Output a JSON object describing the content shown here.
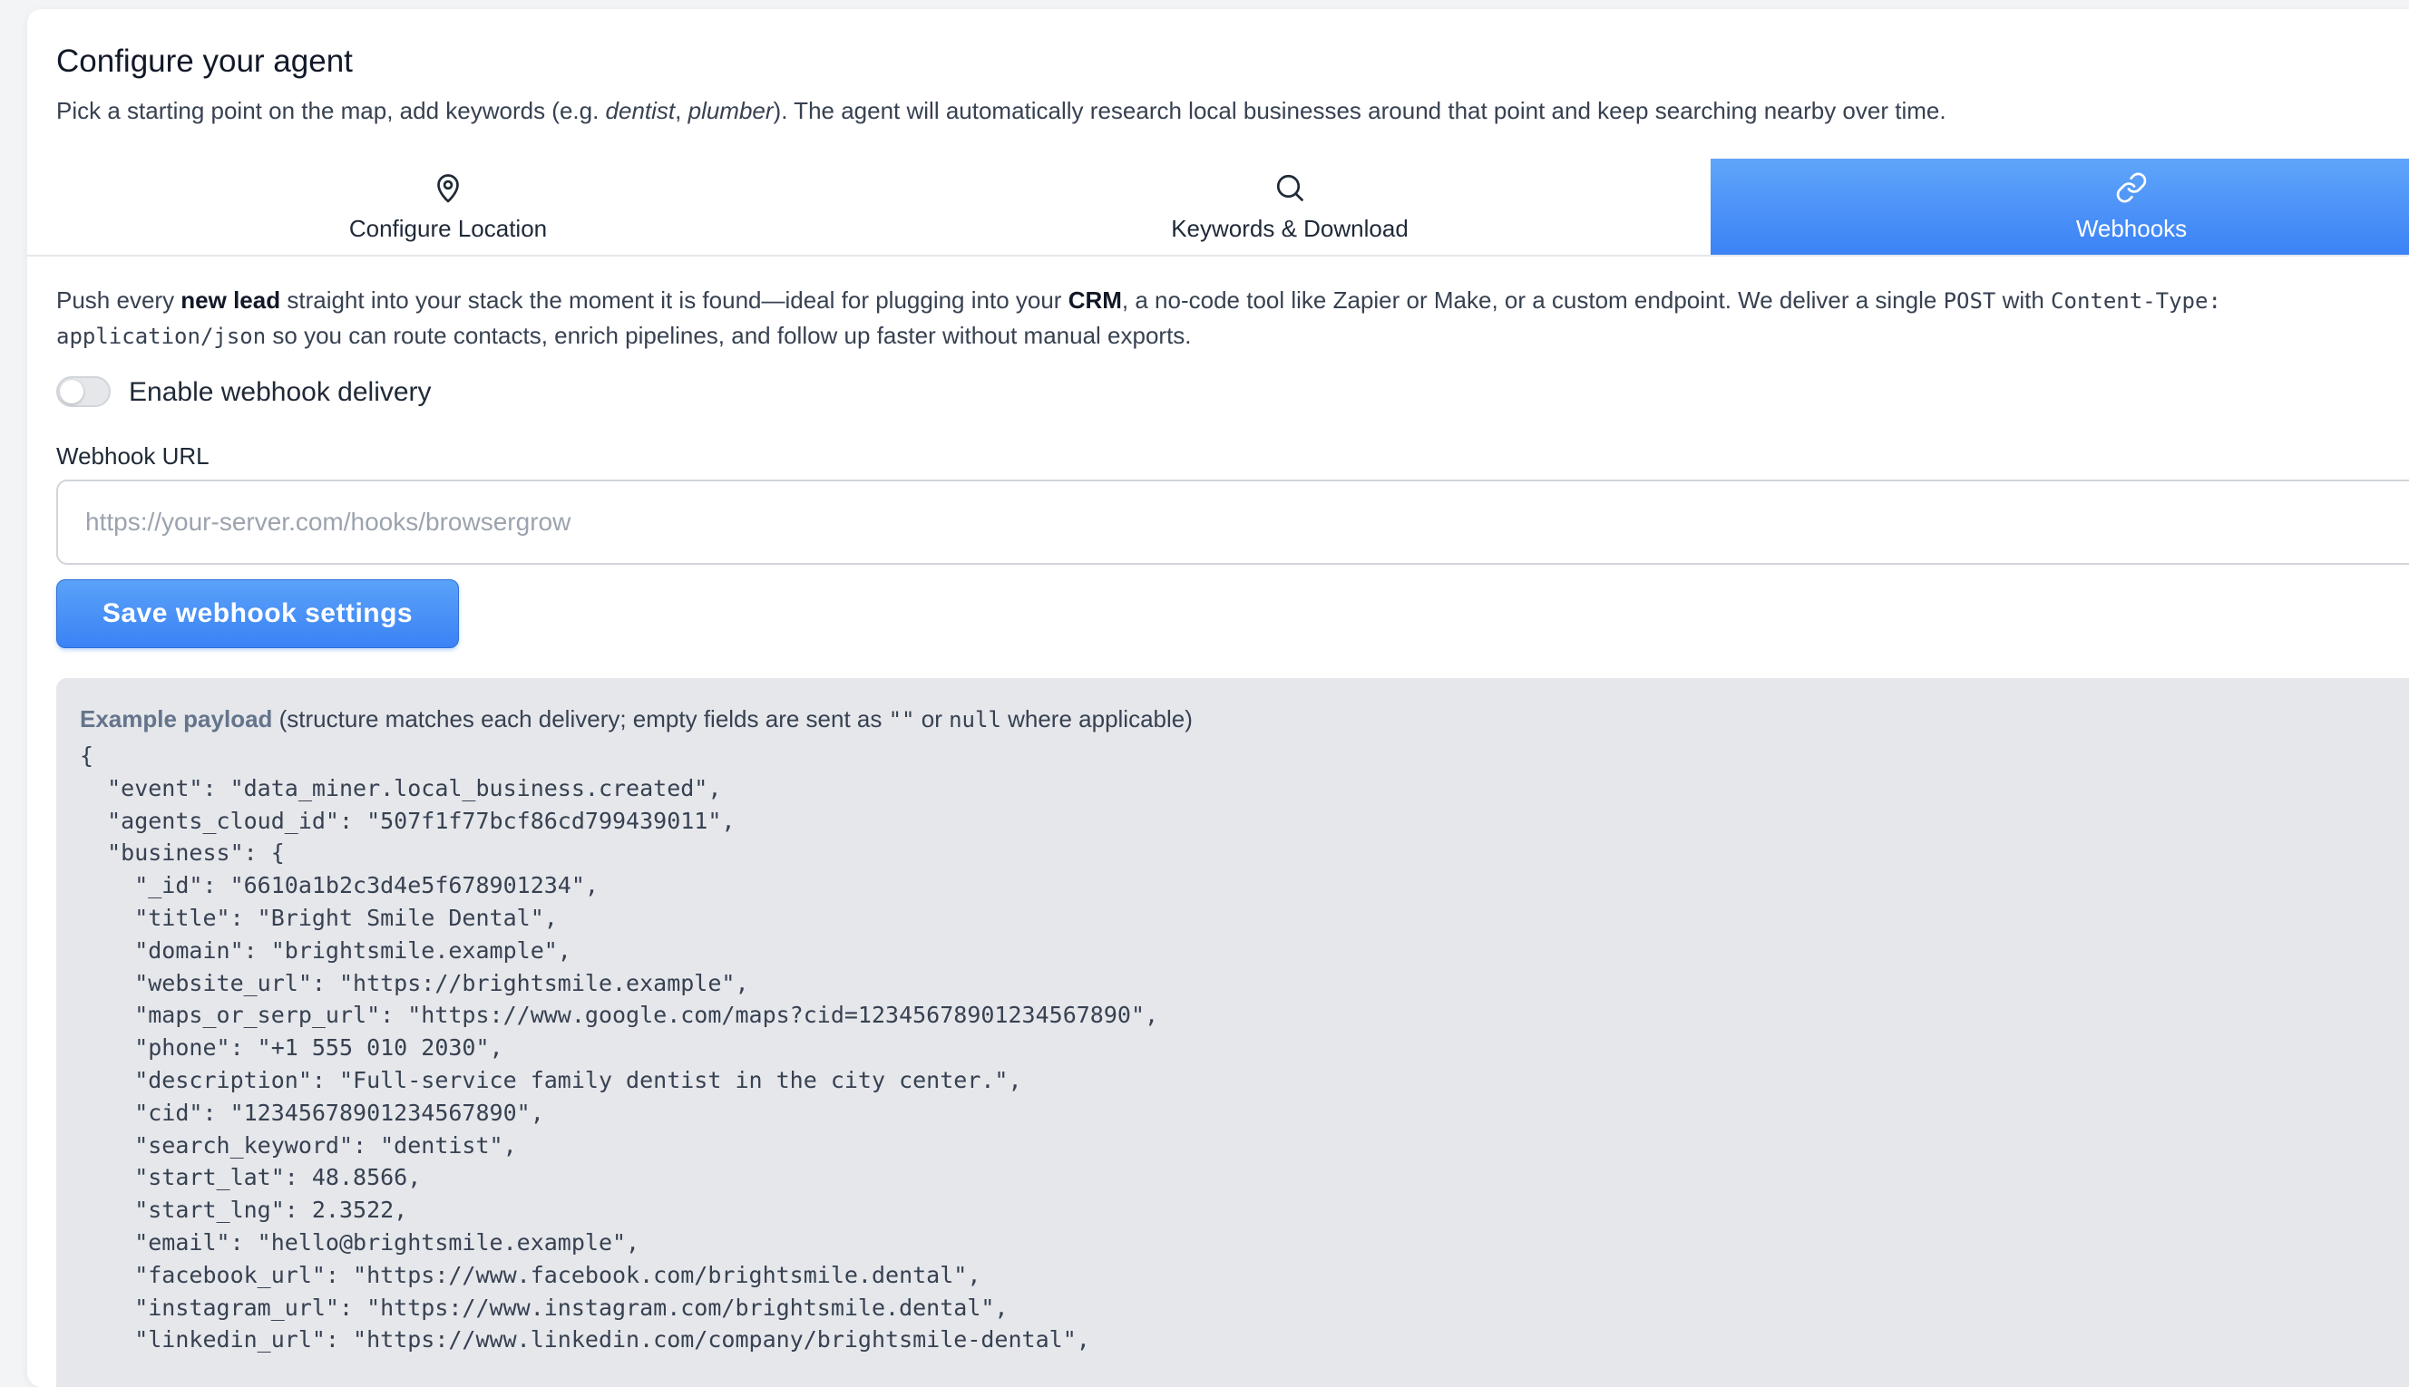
{
  "header": {
    "title": "Configure your agent",
    "desc_1": "Pick a starting point on the map, add keywords (e.g. ",
    "desc_ex1": "dentist",
    "desc_sep": ", ",
    "desc_ex2": "plumber",
    "desc_2": "). The agent will automatically research local businesses around that point and keep searching nearby over time."
  },
  "tabs": [
    {
      "label": "Configure Location",
      "icon": "map-pin-icon",
      "active": false
    },
    {
      "label": "Keywords & Download",
      "icon": "search-icon",
      "active": false
    },
    {
      "label": "Webhooks",
      "icon": "link-icon",
      "active": true
    }
  ],
  "webhooks": {
    "intro_1": "Push every ",
    "intro_b1": "new lead",
    "intro_2": " straight into your stack the moment it is found—ideal for plugging into your ",
    "intro_b2": "CRM",
    "intro_3": ", a no-code tool like Zapier or Make, or a custom endpoint. We deliver a single ",
    "intro_code1": "POST",
    "intro_4": " with ",
    "intro_code2": "Content-Type: application/json",
    "intro_5": " so you can route contacts, enrich pipelines, and follow up faster without manual exports.",
    "toggle_label": "Enable webhook delivery",
    "toggle_enabled": false,
    "url_label": "Webhook URL",
    "url_value": "",
    "url_placeholder": "https://your-server.com/hooks/browsergrow",
    "save_label": "Save webhook settings",
    "payload_title": "Example payload",
    "payload_caption_1": " (structure matches each delivery; empty fields are sent as ",
    "payload_caption_code1": "\"\"",
    "payload_caption_2": " or ",
    "payload_caption_code2": "null",
    "payload_caption_3": " where applicable)",
    "payload_lines": [
      "{",
      "  \"event\": \"data_miner.local_business.created\",",
      "  \"agents_cloud_id\": \"507f1f77bcf86cd799439011\",",
      "  \"business\": {",
      "    \"_id\": \"6610a1b2c3d4e5f678901234\",",
      "    \"title\": \"Bright Smile Dental\",",
      "    \"domain\": \"brightsmile.example\",",
      "    \"website_url\": \"https://brightsmile.example\",",
      "    \"maps_or_serp_url\": \"https://www.google.com/maps?cid=12345678901234567890\",",
      "    \"phone\": \"+1 555 010 2030\",",
      "    \"description\": \"Full-service family dentist in the city center.\",",
      "    \"cid\": \"12345678901234567890\",",
      "    \"search_keyword\": \"dentist\",",
      "    \"start_lat\": 48.8566,",
      "    \"start_lng\": 2.3522,",
      "    \"email\": \"hello@brightsmile.example\",",
      "    \"facebook_url\": \"https://www.facebook.com/brightsmile.dental\",",
      "    \"instagram_url\": \"https://www.instagram.com/brightsmile.dental\",",
      "    \"linkedin_url\": \"https://www.linkedin.com/company/brightsmile-dental\","
    ]
  },
  "colors": {
    "accent": "#3b82f6",
    "accent_light": "#60a5fa",
    "payload_bg": "#e5e7eb"
  }
}
